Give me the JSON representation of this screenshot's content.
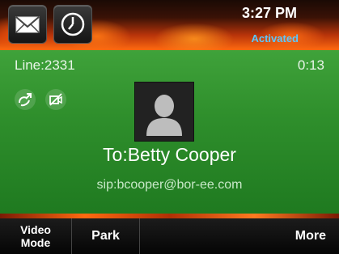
{
  "status_bar": {
    "time": "3:27 PM",
    "status": "Activated",
    "icons": [
      "mail-icon",
      "clock-icon"
    ]
  },
  "call": {
    "line": "Line:2331",
    "duration": "0:13",
    "callee": "To:Betty Cooper",
    "sip_address": "sip:bcooper@bor-ee.com",
    "icons": [
      "transfer-icon",
      "video-disabled-icon",
      "contact-avatar-icon"
    ]
  },
  "softkeys": {
    "video_mode_line1": "Video",
    "video_mode_line2": "Mode",
    "park": "Park",
    "more": "More"
  },
  "colors": {
    "call_background": "#2f8f2c",
    "status_text": "#5bc8ff",
    "flame": "#ff6a10"
  }
}
